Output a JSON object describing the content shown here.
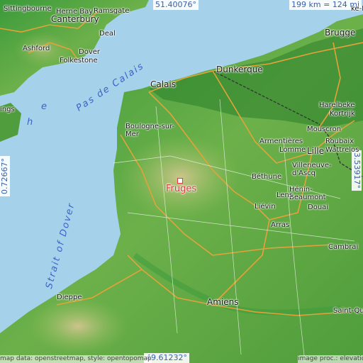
{
  "place": {
    "name": "Fruges"
  },
  "coordinates": {
    "top": "51.40076°",
    "bottom": "49.61232°",
    "left": "0.72667°",
    "right": "3.53917°"
  },
  "scale": "199 km = 124 mi",
  "sea_labels": [
    "Pas de Calais",
    "Strait of Dover"
  ],
  "water_partial": [
    "h",
    "e"
  ],
  "places": [
    "Herne Bay",
    "Sittingbourne",
    "Ramsgate",
    "Canterbury",
    "Deal",
    "Ashford",
    "Dover",
    "Folkestone",
    "ings",
    "Calais",
    "Dunkerque",
    "Brugge",
    "Harelbeke",
    "Kortrijk",
    "Mouscron",
    "Roubaix",
    "Wattrelos",
    "Lille",
    "Villeneuve-d'Ascq",
    "Armentières",
    "Lomme",
    "Boulogne-sur-Mer",
    "Béthune",
    "Hénin-Beaumont",
    "Lens",
    "Liévin",
    "Douai",
    "Arras",
    "Cambrai",
    "Dieppe",
    "Amiens",
    "Saint-Quen",
    "ke-He"
  ],
  "attribution": {
    "left": "map data: openstreetmap, style: opentopomap",
    "right": "image proc.: elevation.city"
  },
  "colors": {
    "sea": "#a6d1ea",
    "land_low": "#2e8b2e",
    "land_mid": "#7ab84a",
    "land_high": "#c9c58a",
    "road": "#e3a23a",
    "border": "#333333",
    "marker": "#e23a3a",
    "coord_text": "#3a5fa8"
  }
}
